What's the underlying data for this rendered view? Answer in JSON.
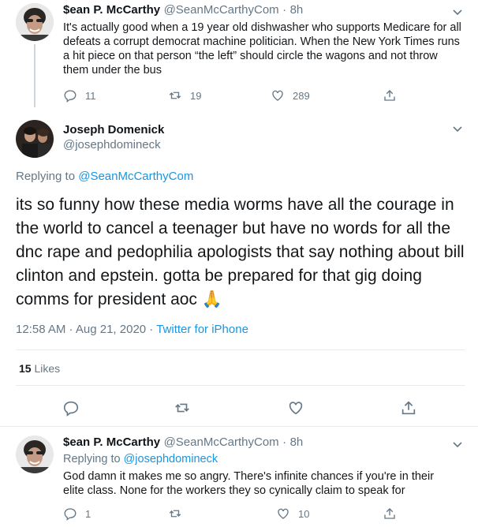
{
  "tweet1": {
    "author_name": "$ean P. McCarthy",
    "handle": "@SeanMcCarthyCom",
    "sep": "·",
    "time": "8h",
    "text": "It's actually good when a 19 year old dishwasher who supports Medicare for all defeats a corrupt democrat machine politician. When the New York Times runs a hit piece on that person “the left” should circle the wagons and not throw them under the bus",
    "replies": "11",
    "retweets": "19",
    "likes": "289"
  },
  "main": {
    "author_name": "Joseph Domenick",
    "handle": "@josephdomineck",
    "replying_prefix": "Replying to ",
    "replying_to": "@SeanMcCarthyCom",
    "text": "its so funny how these media worms have all the courage in the world to cancel a teenager but have no words for all the dnc rape and pedophilia apologists that say nothing about bill clinton and epstein. gotta be prepared for that gig doing comms for president aoc",
    "emoji": "🙏",
    "timestamp": "12:58 AM · Aug 21, 2020",
    "sep": " · ",
    "source": "Twitter for iPhone",
    "likes_count": "15",
    "likes_label": " Likes"
  },
  "tweet3": {
    "author_name": "$ean P. McCarthy",
    "handle": "@SeanMcCarthyCom",
    "sep": "·",
    "time": "8h",
    "replying_prefix": "Replying to ",
    "replying_to": "@josephdomineck",
    "text": "God damn it makes me so angry. There's infinite chances if you're in their elite class. None for the workers they so cynically claim to speak for",
    "replies": "1",
    "likes": "10"
  },
  "colors": {
    "accent": "#1b95e0",
    "muted": "#657786",
    "divider": "#e6ecf0"
  }
}
